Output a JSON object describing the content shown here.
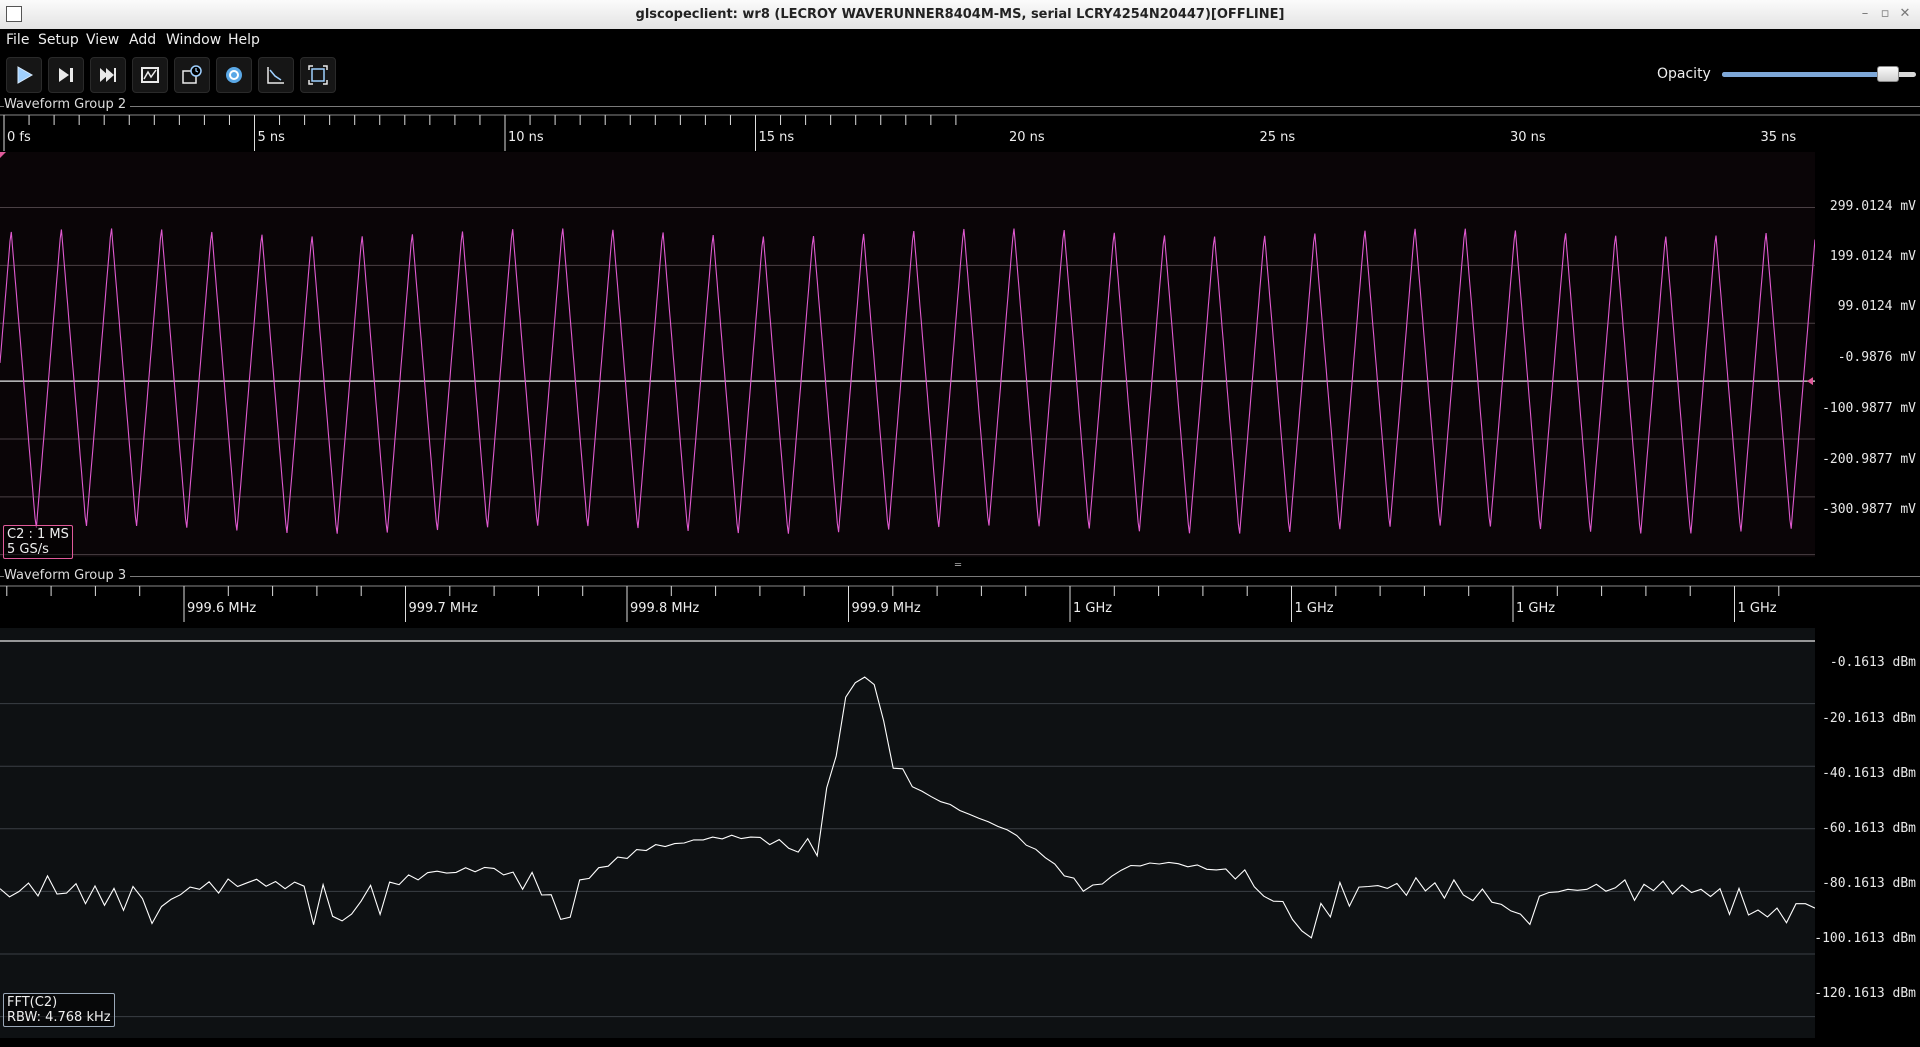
{
  "window": {
    "title": "glscopeclient: wr8 (LECROY WAVERUNNER8404M-MS, serial LCRY4254N20447)[OFFLINE]"
  },
  "menu": [
    "File",
    "Setup",
    "View",
    "Add",
    "Window",
    "Help"
  ],
  "toolbar": {
    "buttons": [
      "start-trigger-icon",
      "single-trigger-icon",
      "force-trigger-icon",
      "stop-trigger-icon",
      "history-icon",
      "refresh-icon",
      "clear-sweeps-icon",
      "fullscreen-icon"
    ],
    "opacity_label": "Opacity",
    "opacity_value": 0.85
  },
  "group2": {
    "label": "Waveform Group 2",
    "time_ticks": [
      "0 fs",
      "5 ns",
      "10 ns",
      "15 ns",
      "20 ns",
      "25 ns",
      "30 ns",
      "35 ns"
    ],
    "y_labels": [
      "299.0124 mV",
      "199.0124 mV",
      "99.0124 mV",
      "-0.9876 mV",
      "-100.9877 mV",
      "-200.9877 mV",
      "-300.9877 mV"
    ],
    "info_line1": "C2 : 1 MS",
    "info_line2": "5 GS/s",
    "color": "#e05ad0"
  },
  "group3": {
    "label": "Waveform Group 3",
    "freq_ticks": [
      "999.6 MHz",
      "999.7 MHz",
      "999.8 MHz",
      "999.9 MHz",
      "1 GHz",
      "1 GHz",
      "1 GHz",
      "1 GHz"
    ],
    "y_labels": [
      "-0.1613 dBm",
      "-20.1613 dBm",
      "-40.1613 dBm",
      "-60.1613 dBm",
      "-80.1613 dBm",
      "-100.1613 dBm",
      "-120.1613 dBm"
    ],
    "info_line1": "FFT(C2)",
    "info_line2": "RBW: 4.768 kHz",
    "color": "#ffffff"
  },
  "chart_data": [
    {
      "type": "line",
      "xlabel": "",
      "ylabel": "",
      "xlim_ns": [
        0,
        36.2
      ],
      "ylim_mV": [
        -305,
        395
      ],
      "series": [
        {
          "period_ns": 1.0,
          "amplitude_mV": 262,
          "offset_mV": -0.99
        }
      ],
      "x": [
        0,
        0.25,
        0.5,
        0.75,
        1,
        1.25,
        1.5,
        1.75,
        2,
        2.25,
        2.5,
        2.75,
        3,
        3.25,
        3.5,
        3.75,
        4,
        4.25,
        4.5,
        4.75,
        5,
        5.25,
        5.5,
        5.75,
        6,
        6.25,
        6.5,
        6.75,
        7,
        7.25,
        7.5,
        7.75,
        8,
        8.25,
        8.5,
        8.75,
        9,
        9.25,
        9.5,
        9.75,
        10,
        10.25,
        10.5,
        10.75,
        11,
        11.25,
        11.5,
        11.75,
        12,
        12.25,
        12.5,
        12.75,
        13,
        13.25,
        13.5,
        13.75,
        14,
        14.25,
        14.5,
        14.75,
        15,
        15.25,
        15.5,
        15.75,
        16,
        16.25,
        16.5,
        16.75,
        17,
        17.25,
        17.5,
        17.75,
        18,
        18.25,
        18.5,
        18.75,
        19,
        19.25,
        19.5,
        19.75,
        20,
        20.25,
        20.5,
        20.75,
        21,
        21.25,
        21.5,
        21.75,
        22,
        22.25,
        22.5,
        22.75,
        23,
        23.25,
        23.5,
        23.75,
        24,
        24.25,
        24.5,
        24.75,
        25,
        25.25,
        25.5,
        25.75,
        26,
        26.25,
        26.5,
        26.75,
        27,
        27.25,
        27.5,
        27.75,
        28,
        28.25,
        28.5,
        28.75,
        29,
        29.25,
        29.5,
        29.75,
        30,
        30.25,
        30.5,
        30.75,
        31,
        31.25,
        31.5,
        31.75,
        32,
        32.25,
        32.5,
        32.75,
        33,
        33.25,
        33.5,
        33.75,
        34,
        34.25,
        34.5,
        34.75,
        35,
        35.25,
        35.5,
        35.75,
        36,
        36.2
      ]
    },
    {
      "type": "line",
      "xlabel": "",
      "ylabel": "",
      "xlim_MHz": [
        999.518,
        1000.336
      ],
      "ylim_dBm": [
        -127,
        4
      ],
      "y": [
        -79.3,
        -81.9,
        -80.2,
        -77.5,
        -81.6,
        -75.2,
        -81.0,
        -80.7,
        -77.7,
        -84.1,
        -78.4,
        -84.6,
        -79.2,
        -86.2,
        -78.6,
        -82.5,
        -90.4,
        -85.0,
        -82.7,
        -81.2,
        -78.8,
        -79.5,
        -77.1,
        -80.7,
        -76.2,
        -78.6,
        -77.4,
        -76.3,
        -78.5,
        -77.0,
        -79.3,
        -77.2,
        -78.5,
        -90.8,
        -78.0,
        -88.1,
        -89.6,
        -87.4,
        -83.3,
        -78.2,
        -87.5,
        -77.2,
        -78.0,
        -74.9,
        -76.5,
        -74.2,
        -73.7,
        -74.3,
        -74.1,
        -72.6,
        -73.9,
        -72.5,
        -72.8,
        -74.9,
        -74.0,
        -79.5,
        -74.1,
        -81.3,
        -81.2,
        -89.1,
        -88.4,
        -76.5,
        -76.0,
        -72.6,
        -72.1,
        -69.2,
        -69.6,
        -66.8,
        -67.1,
        -65.2,
        -65.8,
        -64.9,
        -64.7,
        -63.7,
        -63.7,
        -62.8,
        -63.4,
        -62.2,
        -63.3,
        -62.8,
        -62.9,
        -65.2,
        -63.6,
        -66.4,
        -67.6,
        -63.3,
        -68.8,
        -47.1,
        -36.9,
        -18.1,
        -13.5,
        -11.7,
        -14.1,
        -25.7,
        -40.8,
        -41.0,
        -46.7,
        -48.1,
        -49.9,
        -51.5,
        -52.4,
        -54.3,
        -55.5,
        -56.8,
        -57.9,
        -59.4,
        -60.5,
        -62.3,
        -65.4,
        -66.7,
        -69.4,
        -71.4,
        -75.2,
        -75.9,
        -80.1,
        -78.1,
        -77.8,
        -75.3,
        -73.4,
        -71.9,
        -72.0,
        -71.1,
        -71.4,
        -70.9,
        -71.3,
        -72.3,
        -71.7,
        -73.1,
        -73.3,
        -73.0,
        -76.2,
        -73.3,
        -78.7,
        -81.7,
        -83.3,
        -83.4,
        -89.1,
        -92.8,
        -95.0,
        -84.0,
        -88.3,
        -77.3,
        -84.9,
        -78.8,
        -78.6,
        -78.3,
        -79.2,
        -77.6,
        -81.4,
        -75.8,
        -80.0,
        -77.4,
        -82.3,
        -76.5,
        -81.3,
        -83.1,
        -79.4,
        -83.6,
        -84.3,
        -86.4,
        -87.4,
        -90.7,
        -81.7,
        -80.5,
        -80.3,
        -79.5,
        -79.8,
        -79.5,
        -77.9,
        -80.1,
        -79.0,
        -76.5,
        -83.0,
        -77.9,
        -79.9,
        -76.9,
        -81.0,
        -78.1,
        -80.5,
        -79.5,
        -81.8,
        -79.3,
        -87.5,
        -79.2,
        -87.7,
        -86.1,
        -88.3,
        -85.5,
        -90.2,
        -84.1,
        -84.1,
        -85.5
      ]
    }
  ]
}
